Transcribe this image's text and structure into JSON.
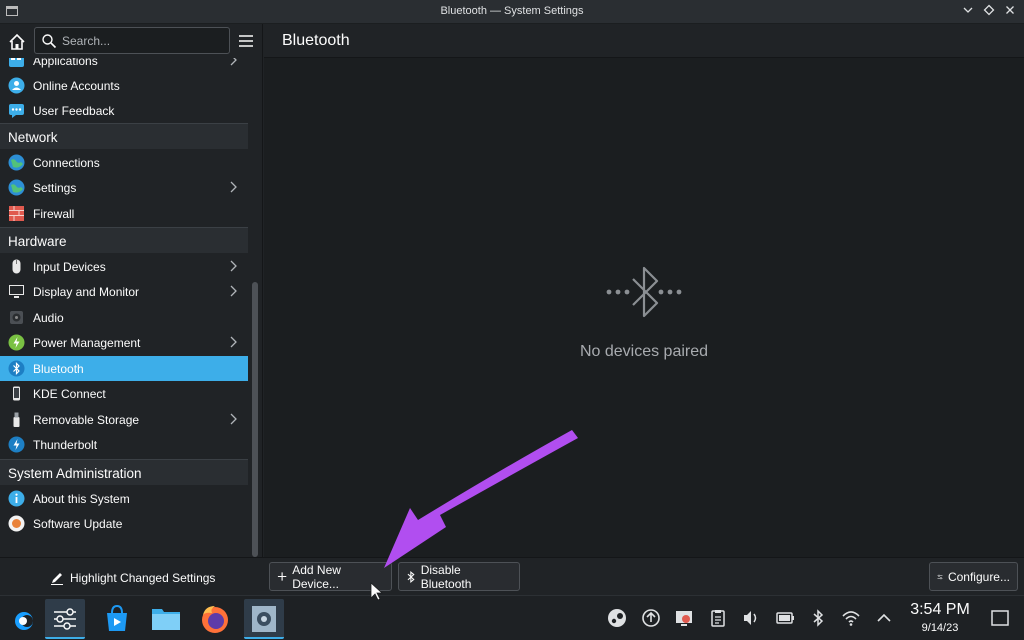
{
  "window": {
    "title": "Bluetooth — System Settings"
  },
  "search": {
    "placeholder": "Search..."
  },
  "sidebar": {
    "items": [
      {
        "label": "Applications",
        "icon": "applications-icon",
        "chevron": true
      },
      {
        "label": "Online Accounts",
        "icon": "online-accounts-icon"
      },
      {
        "label": "User Feedback",
        "icon": "user-feedback-icon"
      }
    ],
    "sections": [
      {
        "title": "Network",
        "items": [
          {
            "label": "Connections",
            "icon": "globe-icon"
          },
          {
            "label": "Settings",
            "icon": "globe-icon",
            "chevron": true
          },
          {
            "label": "Firewall",
            "icon": "firewall-icon"
          }
        ]
      },
      {
        "title": "Hardware",
        "items": [
          {
            "label": "Input Devices",
            "icon": "mouse-icon",
            "chevron": true
          },
          {
            "label": "Display and Monitor",
            "icon": "monitor-icon",
            "chevron": true
          },
          {
            "label": "Audio",
            "icon": "speaker-icon"
          },
          {
            "label": "Power Management",
            "icon": "power-icon",
            "chevron": true
          },
          {
            "label": "Bluetooth",
            "icon": "bluetooth-icon",
            "selected": true
          },
          {
            "label": "KDE Connect",
            "icon": "phone-icon"
          },
          {
            "label": "Removable Storage",
            "icon": "usb-icon",
            "chevron": true
          },
          {
            "label": "Thunderbolt",
            "icon": "thunderbolt-icon"
          }
        ]
      },
      {
        "title": "System Administration",
        "items": [
          {
            "label": "About this System",
            "icon": "info-icon"
          },
          {
            "label": "Software Update",
            "icon": "update-icon"
          }
        ]
      }
    ]
  },
  "main": {
    "title": "Bluetooth",
    "empty_message": "No devices paired"
  },
  "footer": {
    "highlight_label": "Highlight Changed Settings",
    "add_device_label": "Add New Device...",
    "disable_label": "Disable Bluetooth",
    "configure_label": "Configure..."
  },
  "taskbar": {
    "time": "3:54 PM",
    "date": "9/14/23"
  },
  "colors": {
    "accent": "#3daee9",
    "annotation_arrow": "#b14ef0"
  }
}
